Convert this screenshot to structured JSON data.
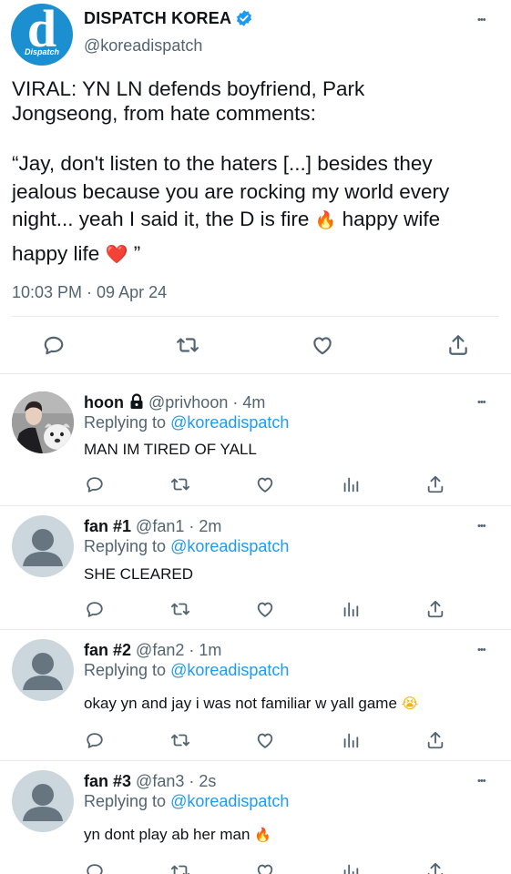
{
  "main_tweet": {
    "avatar_text": "d",
    "avatar_sub": "Dispatch",
    "display_name": "DISPATCH KOREA",
    "handle": "@koreadispatch",
    "text_line1": "VIRAL: YN LN defends boyfriend, Park",
    "text_line2": "Jongseong, from hate comments:",
    "quote_line1": "“Jay, don't listen to the haters [...] besides they",
    "quote_line2": "jealous because you are rocking my world every",
    "quote_line3a": "night... yeah I said it, the D is fire",
    "quote_line3b": "happy wife",
    "quote_line4": "happy life",
    "quote_end": "”",
    "fire_emoji": "🔥",
    "heart_emoji": "❤️",
    "timestamp": "10:03 PM · 09 Apr 24",
    "more": "•••"
  },
  "replies": [
    {
      "name": "hoon",
      "lock": true,
      "handle": "@privhoon",
      "time": "· 4m",
      "replying_prefix": "Replying to",
      "replying_handle": "@koreadispatch",
      "text": "MAN IM TIRED OF YALL",
      "emoji": "",
      "more": "•••"
    },
    {
      "name": "fan #1",
      "handle": "@fan1",
      "time": "· 2m",
      "replying_prefix": "Replying to",
      "replying_handle": "@koreadispatch",
      "text": "SHE CLEARED",
      "emoji": "",
      "more": "•••"
    },
    {
      "name": "fan #2",
      "handle": "@fan2",
      "time": "· 1m",
      "replying_prefix": "Replying to",
      "replying_handle": "@koreadispatch",
      "text": "okay yn and jay i was not familiar w yall game",
      "emoji": "😭",
      "more": "•••"
    },
    {
      "name": "fan #3",
      "handle": "@fan3",
      "time": "· 2s",
      "replying_prefix": "Replying to",
      "replying_handle": "@koreadispatch",
      "text": "yn dont play ab her man",
      "emoji": "🔥",
      "more": "•••"
    }
  ],
  "colors": {
    "accent": "#1d9bf0",
    "muted": "#536471",
    "divider": "#e6e9eb",
    "avatar_bg": "#ccd6dd",
    "avatar_fg": "#66757f",
    "emoji_red": "#e53935",
    "emoji_fire": "#ff8a00"
  }
}
